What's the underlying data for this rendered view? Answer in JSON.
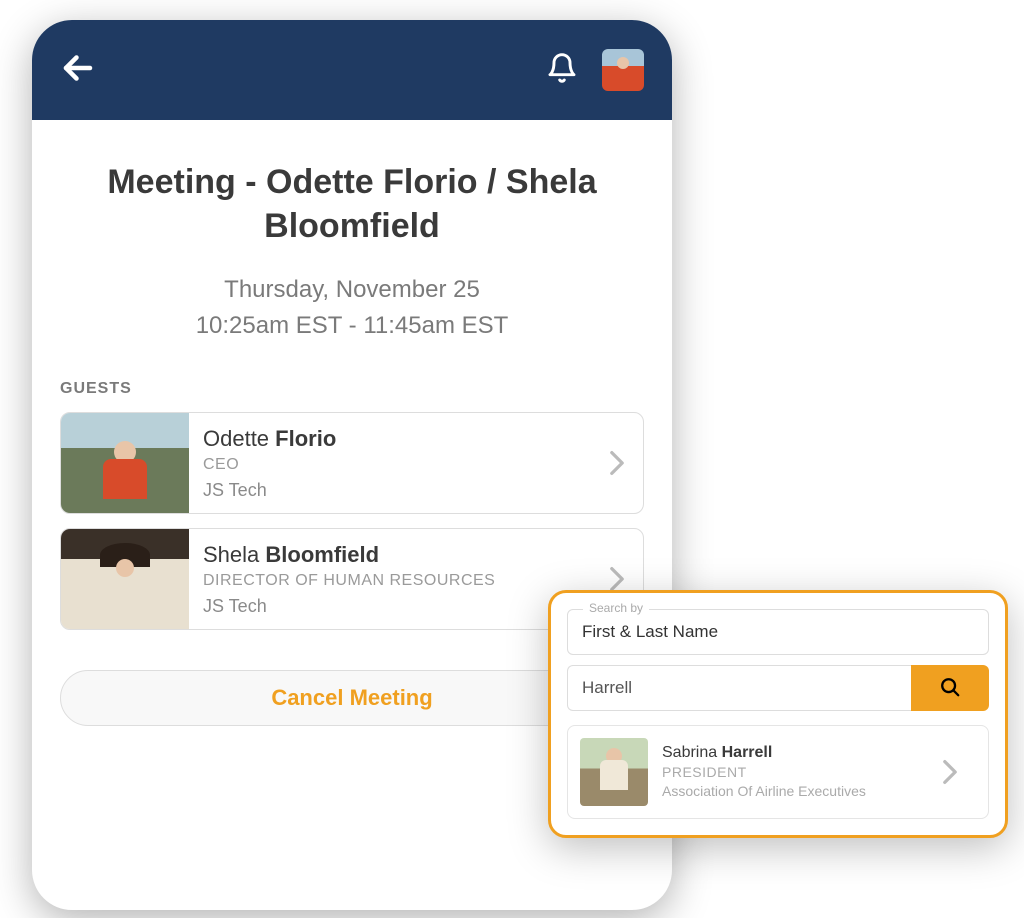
{
  "meeting": {
    "title": "Meeting - Odette Florio / Shela Bloomfield",
    "date": "Thursday, November 25",
    "time": "10:25am EST - 11:45am EST",
    "guests_label": "GUESTS",
    "guests": [
      {
        "first": "Odette",
        "last": "Florio",
        "title": "CEO",
        "company": "JS Tech"
      },
      {
        "first": "Shela",
        "last": "Bloomfield",
        "title": "DIRECTOR OF HUMAN RESOURCES",
        "company": "JS Tech"
      }
    ],
    "cancel_label": "Cancel Meeting"
  },
  "search": {
    "label": "Search by",
    "mode": "First & Last Name",
    "query": "Harrell",
    "results": [
      {
        "first": "Sabrina",
        "last": "Harrell",
        "title": "PRESIDENT",
        "org": "Association Of Airline Executives"
      }
    ]
  }
}
